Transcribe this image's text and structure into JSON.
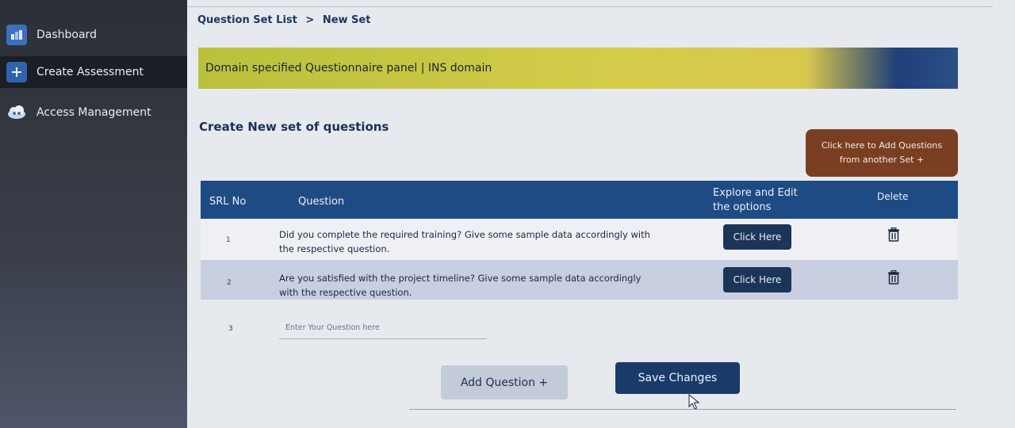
{
  "sidebar": {
    "items": [
      {
        "label": "Dashboard",
        "icon": "dashboard-icon"
      },
      {
        "label": "Create Assessment",
        "icon": "plus-icon",
        "active": true
      },
      {
        "label": "Access Management",
        "icon": "users-cloud-icon"
      }
    ]
  },
  "breadcrumb": {
    "parent": "Question Set List",
    "separator": ">",
    "current": "New Set"
  },
  "banner": {
    "text": "Domain specified Questionnaire panel | INS domain"
  },
  "section": {
    "title": "Create New set of questions",
    "add_from_set_label": "Click here to Add Questions from another Set +"
  },
  "table": {
    "headers": {
      "srl": "SRL No",
      "question": "Question",
      "explore_line1": "Explore and Edit",
      "explore_line2": "the options",
      "delete": "Delete"
    },
    "rows": [
      {
        "srl": "1",
        "question": "Did you complete the required training? Give some sample data accordingly with the respective question.",
        "action": "Click Here"
      },
      {
        "srl": "2",
        "question": "Are you satisfied with the project timeline? Give some sample data accordingly with the respective question.",
        "action": "Click Here"
      }
    ],
    "new_row": {
      "srl": "3",
      "placeholder": "Enter Your Question here"
    }
  },
  "actions": {
    "add_question": "Add Question +",
    "save_changes": "Save Changes"
  },
  "colors": {
    "sidebar_bg": "#2b2f36",
    "table_header": "#1f4b84",
    "primary_button": "#1a3a6a",
    "accent_button": "#7a3f22",
    "banner_yellow": "#c8c640"
  }
}
